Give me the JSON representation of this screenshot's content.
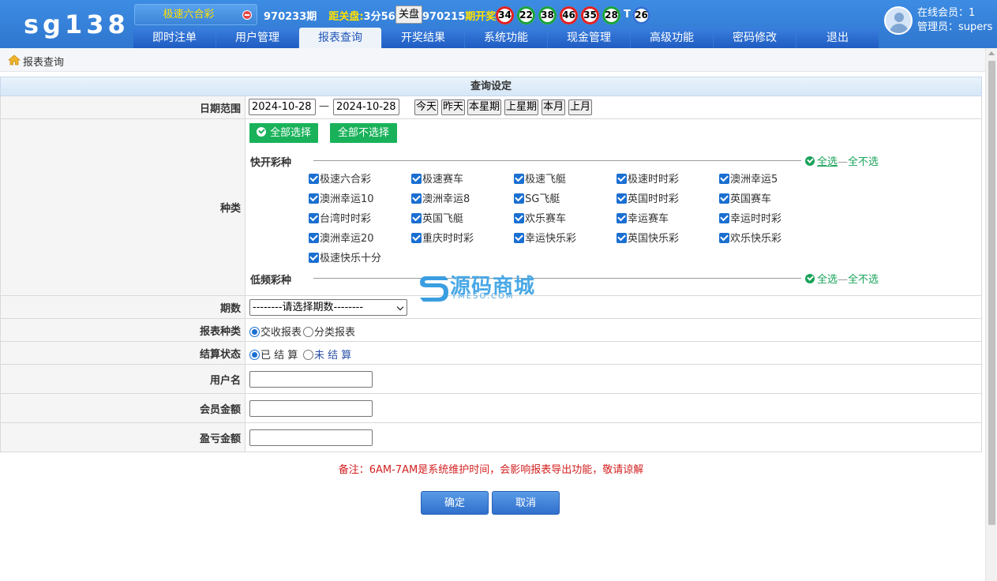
{
  "header": {
    "logo": "sg138",
    "game": "极速六合彩",
    "current_issue": "970233期",
    "countdown_label": "距关盘:",
    "countdown": "3分56秒",
    "close_button": "关盘",
    "last_issue": "970215",
    "last_label": "期开奖:",
    "balls": [
      {
        "n": "34",
        "color": "red"
      },
      {
        "n": "22",
        "color": "green"
      },
      {
        "n": "38",
        "color": "green"
      },
      {
        "n": "46",
        "color": "red"
      },
      {
        "n": "35",
        "color": "red"
      },
      {
        "n": "28",
        "color": "green"
      },
      {
        "n": "26",
        "color": "blue"
      }
    ],
    "special_sep": "T",
    "online_label": "在线会员：1",
    "admin_label": "管理员：supers"
  },
  "nav": {
    "items": [
      "即时注单",
      "用户管理",
      "报表查询",
      "开奖结果",
      "系统功能",
      "现金管理",
      "高级功能",
      "密码修改",
      "退出"
    ],
    "active_index": 2
  },
  "breadcrumb": "报表查询",
  "form": {
    "title": "查询设定",
    "date_label": "日期范围",
    "date_from": "2024-10-28",
    "date_sep": "—",
    "date_to": "2024-10-28",
    "date_buttons": [
      "今天",
      "昨天",
      "本星期",
      "上星期",
      "本月",
      "上月"
    ],
    "type_label": "种类",
    "select_all_btn": "全部选择",
    "deselect_all_btn": "全部不选择",
    "fast_title": "快开彩种",
    "slow_title": "低频彩种",
    "sel_all": "全选",
    "sel_none": "全不选",
    "sel_dash": "—",
    "games": [
      "极速六合彩",
      "极速赛车",
      "极速飞艇",
      "极速时时彩",
      "澳洲幸运5",
      "澳洲幸运10",
      "澳洲幸运8",
      "SG飞艇",
      "英国时时彩",
      "英国赛车",
      "台湾时时彩",
      "英国飞艇",
      "欢乐赛车",
      "幸运赛车",
      "幸运时时彩",
      "澳洲幸运20",
      "重庆时时彩",
      "幸运快乐彩",
      "英国快乐彩",
      "欢乐快乐彩",
      "极速快乐十分"
    ],
    "issue_label": "期数",
    "issue_select": "--------请选择期数--------",
    "report_type_label": "报表种类",
    "report_types": [
      "交收报表",
      "分类报表"
    ],
    "settle_label": "结算状态",
    "settle_options": [
      "已 结 算",
      "未 结 算"
    ],
    "username_label": "用户名",
    "member_amount_label": "会员金额",
    "profit_label": "盈亏金额",
    "note": "备注：6AM-7AM是系统维护时间，会影响报表导出功能，敬请谅解",
    "ok": "确定",
    "cancel": "取消"
  },
  "watermark": {
    "title": "源码商城",
    "sub": "YMESO.COM"
  }
}
